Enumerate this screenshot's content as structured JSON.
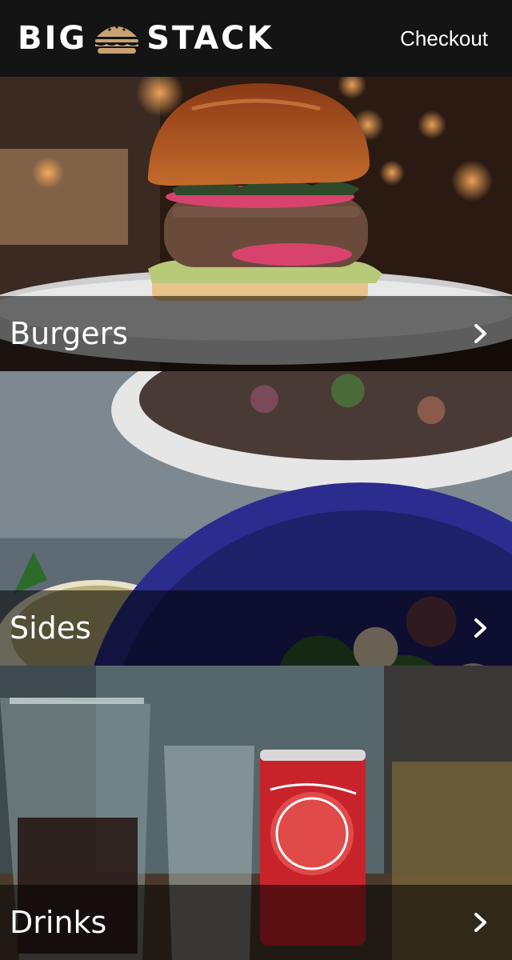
{
  "header": {
    "logo_left": "BIG",
    "logo_right": "STACK",
    "checkout_label": "Checkout"
  },
  "categories": [
    {
      "label": "Burgers",
      "image": "burger-photo"
    },
    {
      "label": "Sides",
      "image": "salad-photo"
    },
    {
      "label": "Drinks",
      "image": "drinks-photo"
    }
  ],
  "colors": {
    "header_bg": "#141414",
    "logo_accent": "#c9a272",
    "label_bar_bg": "rgba(0,0,0,0.55)"
  }
}
